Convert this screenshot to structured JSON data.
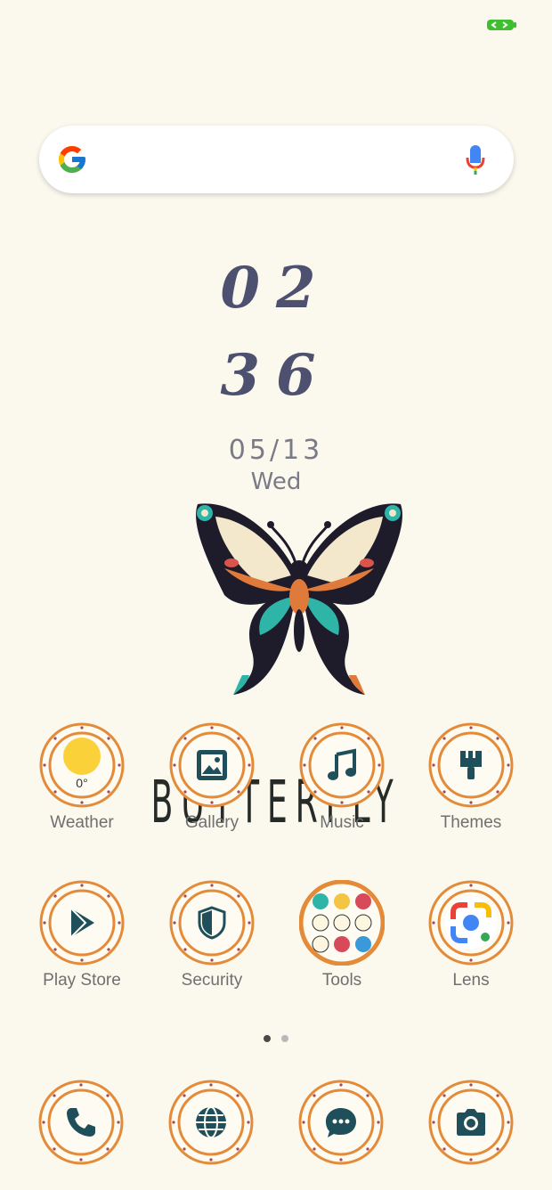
{
  "status": {
    "battery_color": "#3fbf2f"
  },
  "search": {
    "google_icon": "google-g-icon",
    "mic_icon": "microphone-icon"
  },
  "clock": {
    "hours": "02",
    "minutes": "36",
    "date": "05/13",
    "weekday": "Wed"
  },
  "wordmark": "BUTTERFLY",
  "apps_row1": [
    {
      "label": "Weather",
      "icon": "weather-sun-icon",
      "temp": "0°"
    },
    {
      "label": "Gallery",
      "icon": "image-icon"
    },
    {
      "label": "Music",
      "icon": "music-note-icon"
    },
    {
      "label": "Themes",
      "icon": "paintbrush-icon"
    }
  ],
  "apps_row2": [
    {
      "label": "Play Store",
      "icon": "play-store-icon"
    },
    {
      "label": "Security",
      "icon": "shield-icon"
    },
    {
      "label": "Tools",
      "icon": "tools-folder-icon"
    },
    {
      "label": "Lens",
      "icon": "google-lens-icon"
    }
  ],
  "dock": [
    {
      "icon": "phone-icon"
    },
    {
      "icon": "globe-icon"
    },
    {
      "icon": "message-icon"
    },
    {
      "icon": "camera-icon"
    }
  ],
  "pager": {
    "pages": 2,
    "current": 1
  },
  "theme": {
    "accent": "#e48b3a",
    "icon_color": "#1f4f5b",
    "dot": "#a54a55"
  }
}
